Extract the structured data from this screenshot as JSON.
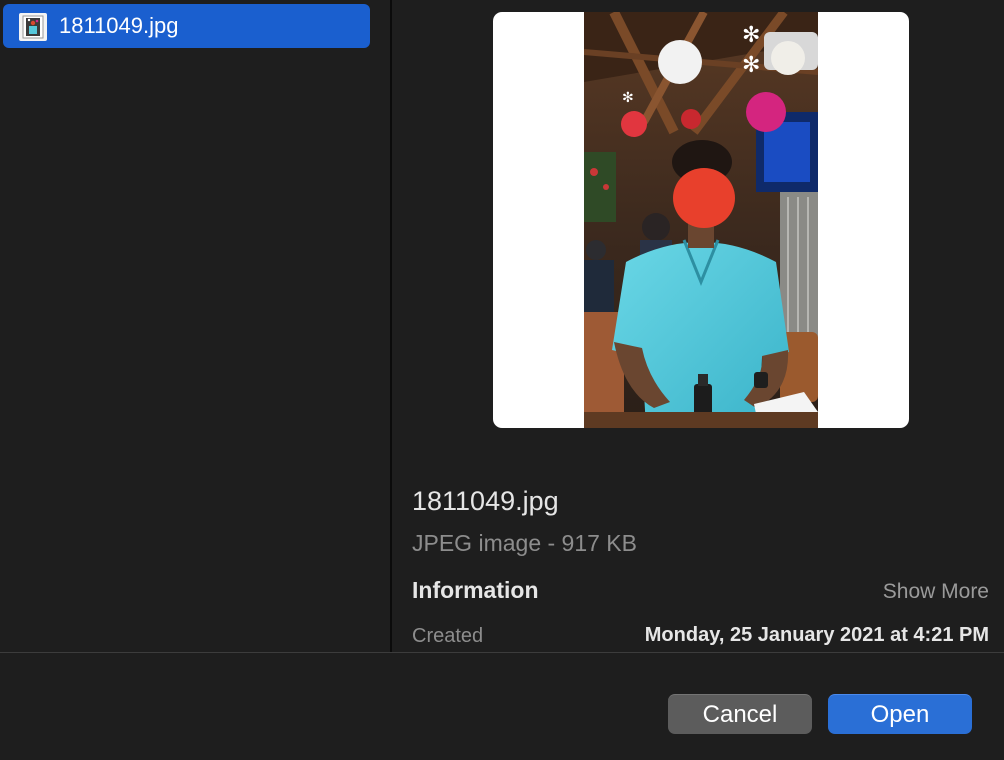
{
  "file_list": {
    "items": [
      {
        "name": "1811049.jpg",
        "selected": true,
        "icon": "image-file-icon"
      }
    ]
  },
  "preview": {
    "file_name": "1811049.jpg",
    "kind_size": "JPEG image - 917 KB",
    "info_heading": "Information",
    "show_more_label": "Show More",
    "created_label": "Created",
    "created_value": "Monday, 25 January 2021 at 4:21 PM"
  },
  "buttons": {
    "cancel_label": "Cancel",
    "open_label": "Open"
  },
  "colors": {
    "selection": "#1a5fcf",
    "primary_button": "#2a6fd6",
    "secondary_button": "#5c5c5c",
    "background": "#1e1e1e"
  }
}
